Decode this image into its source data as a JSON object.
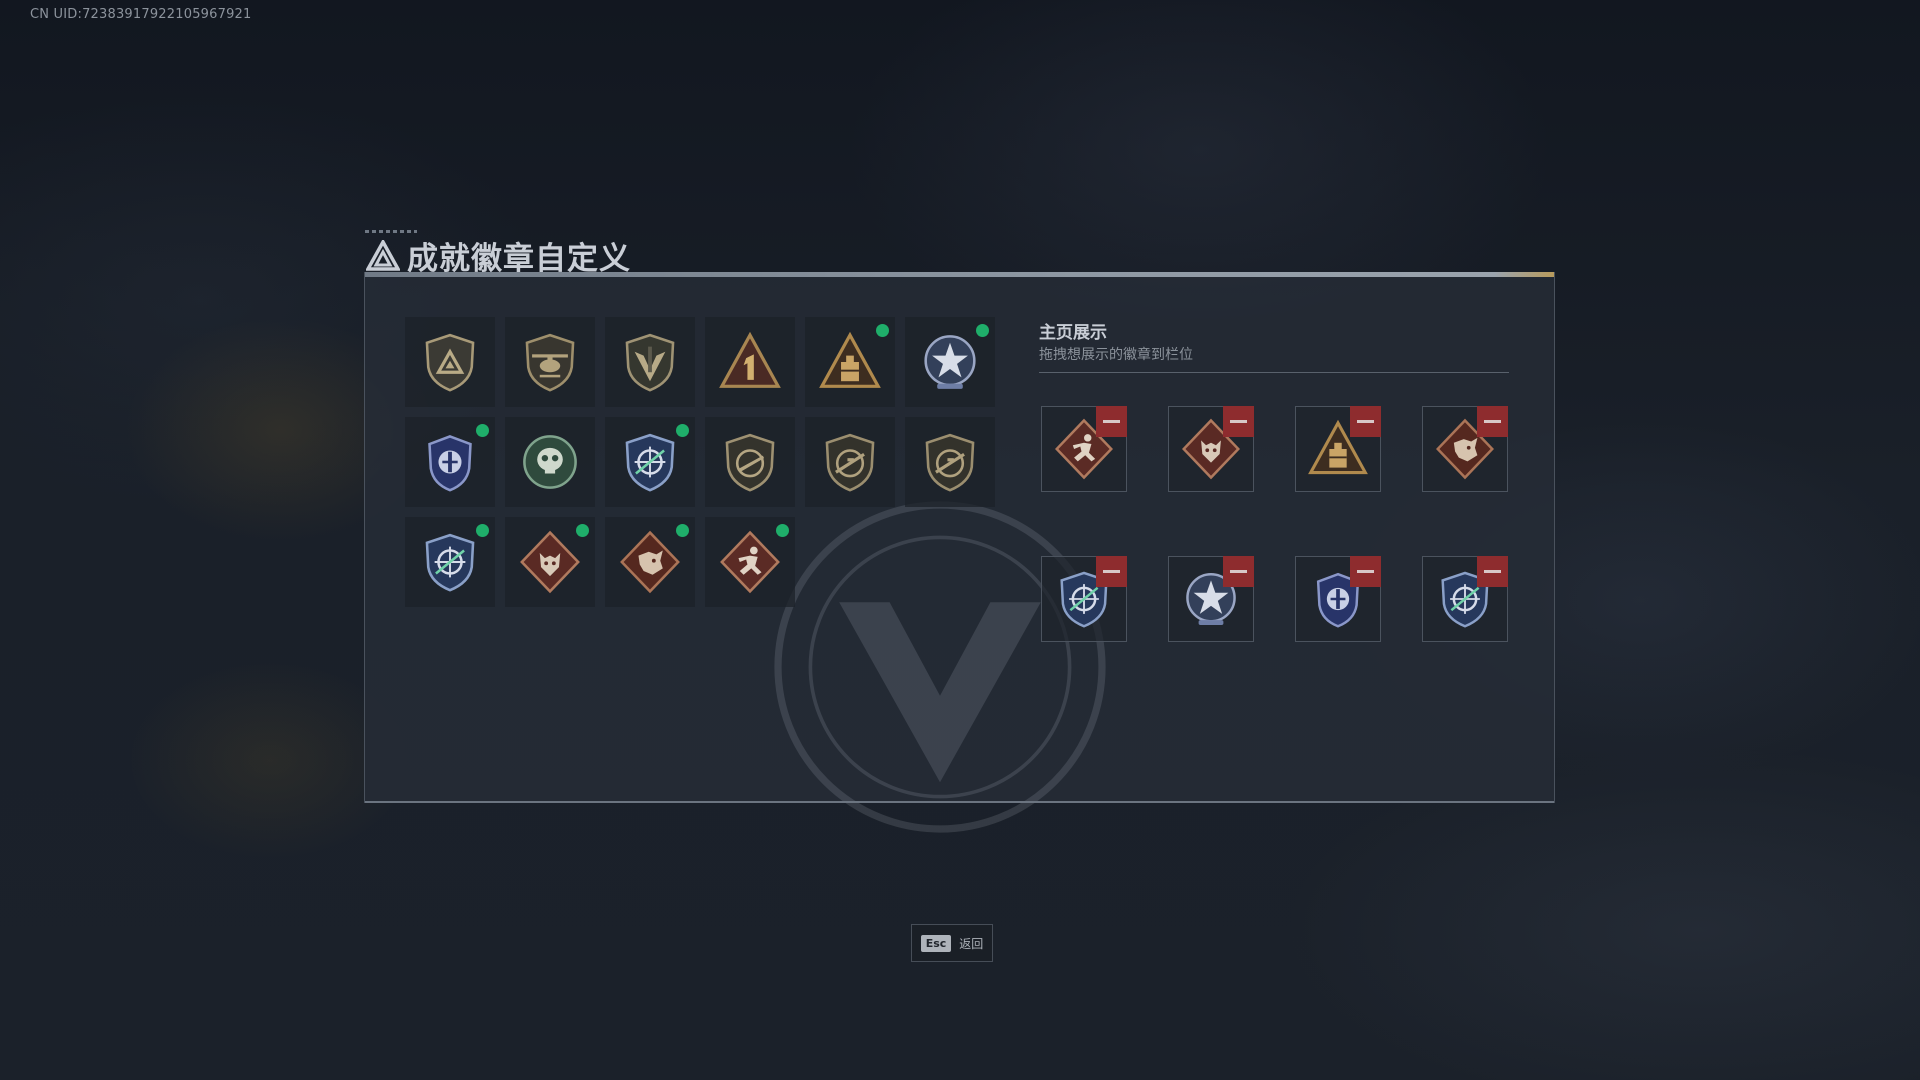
{
  "uid": "CN UID:72383917922105967921",
  "page": {
    "title": "成就徽章自定义"
  },
  "badges": [
    {
      "icon": "shield-triangle-badge-icon",
      "is_new": false
    },
    {
      "icon": "helicopter-badge-icon",
      "is_new": false
    },
    {
      "icon": "winged-shield-badge-icon",
      "is_new": false
    },
    {
      "icon": "number-one-triangle-badge-icon",
      "is_new": false
    },
    {
      "icon": "supply-crate-triangle-badge-icon",
      "is_new": true
    },
    {
      "icon": "star-emblem-badge-icon",
      "is_new": true
    },
    {
      "icon": "blue-crest-badge-icon",
      "is_new": true
    },
    {
      "icon": "green-skull-badge-icon",
      "is_new": false
    },
    {
      "icon": "crosshair-shield-badge-icon",
      "is_new": true
    },
    {
      "icon": "rifle-shield-badge-icon",
      "is_new": false
    },
    {
      "icon": "sniper-shield-badge-icon",
      "is_new": false
    },
    {
      "icon": "sniper-shield-badge-icon",
      "is_new": false
    },
    {
      "icon": "crosshair-shield-badge-icon",
      "is_new": true
    },
    {
      "icon": "wolf-diamond-badge-icon",
      "is_new": true
    },
    {
      "icon": "dragon-diamond-badge-icon",
      "is_new": true
    },
    {
      "icon": "runner-diamond-badge-icon",
      "is_new": true
    }
  ],
  "showcase": {
    "title": "主页展示",
    "subtitle": "拖拽想展示的徽章到栏位",
    "slots": [
      {
        "icon": "runner-diamond-badge-icon"
      },
      {
        "icon": "wolf-diamond-badge-icon"
      },
      {
        "icon": "supply-crate-triangle-badge-icon"
      },
      {
        "icon": "dragon-diamond-badge-icon"
      },
      {
        "icon": "crosshair-shield-badge-icon"
      },
      {
        "icon": "star-emblem-badge-icon"
      },
      {
        "icon": "blue-crest-badge-icon"
      },
      {
        "icon": "crosshair-shield-badge-icon"
      }
    ]
  },
  "footer": {
    "esc_key": "Esc",
    "esc_label": "返回"
  },
  "colors": {
    "new_indicator": "#1fae6a",
    "remove_button": "#8e2c2e",
    "panel_bg": "#262d37"
  }
}
